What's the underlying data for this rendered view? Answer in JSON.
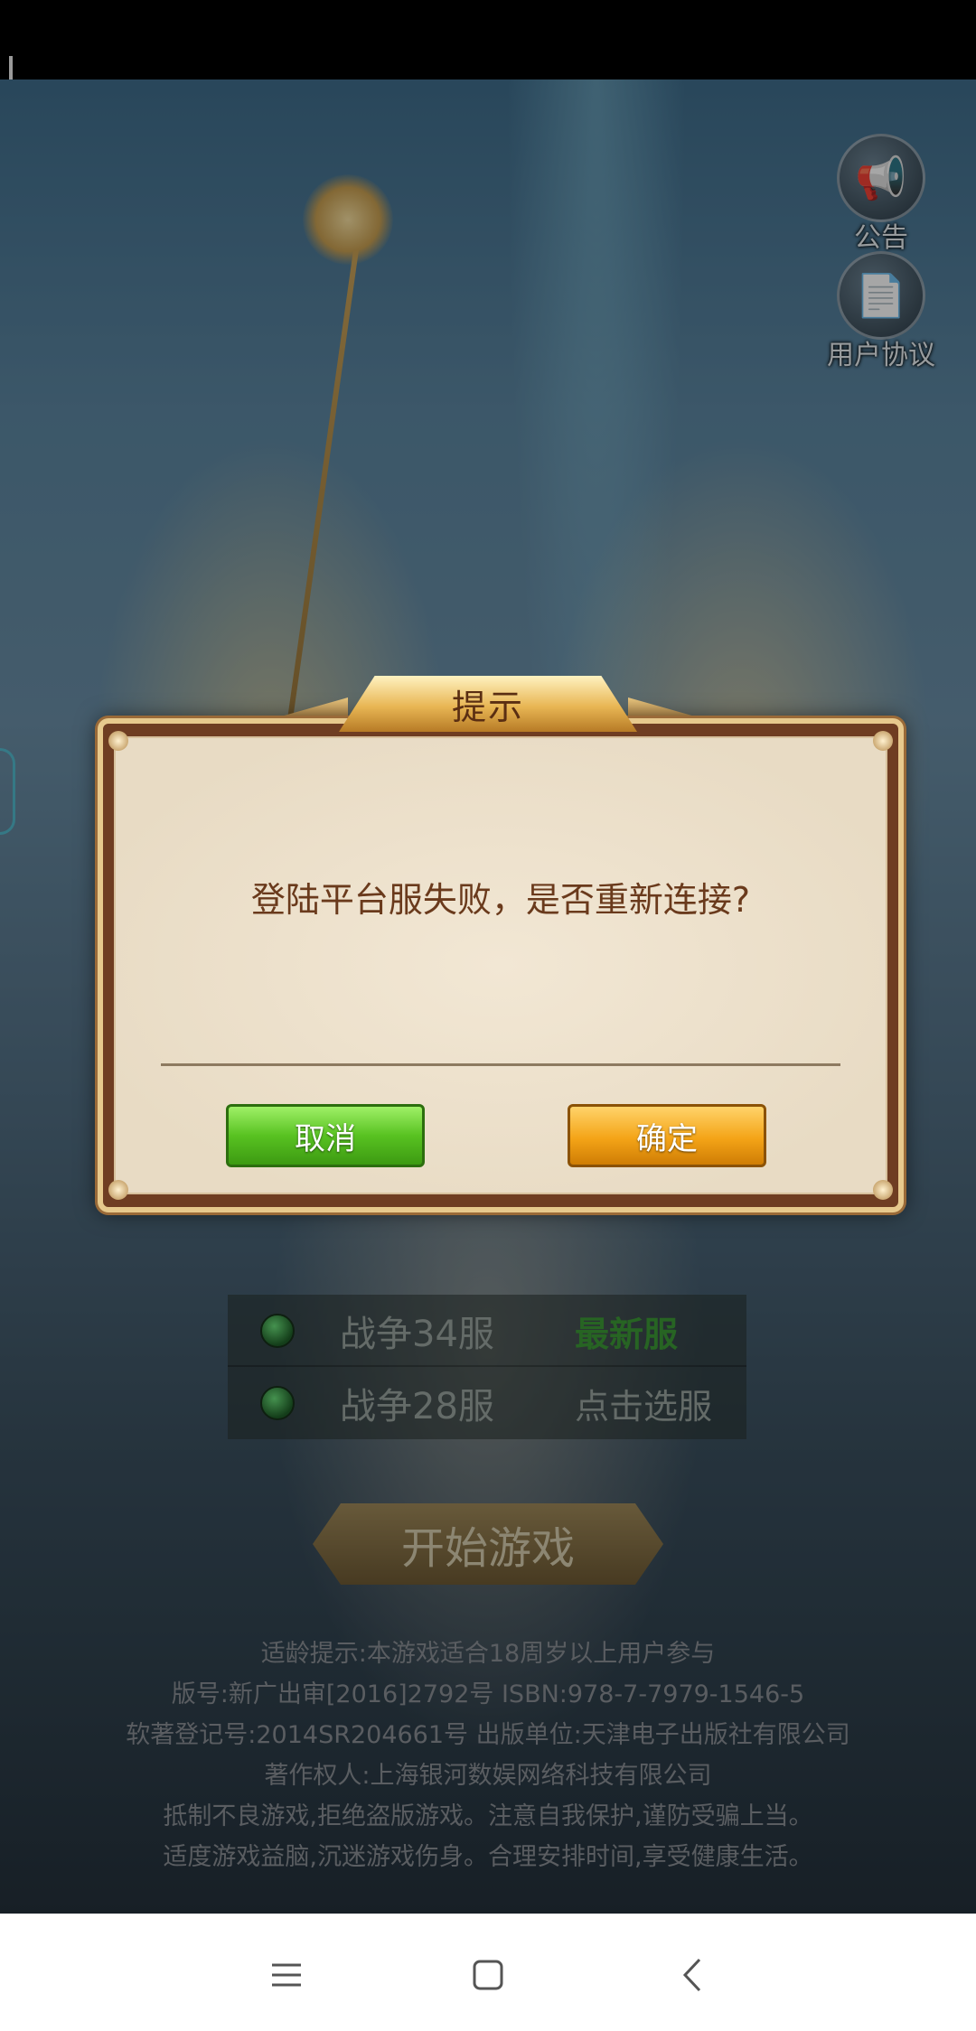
{
  "side_buttons": {
    "announcement": "公告",
    "user_agreement": "用户协议"
  },
  "servers": [
    {
      "name": "战争34服",
      "tag": "最新服"
    },
    {
      "name": "战争28服",
      "tag": "点击选服"
    }
  ],
  "start_button": "开始游戏",
  "legal_lines": [
    "适龄提示:本游戏适合18周岁以上用户参与",
    "版号:新广出审[2016]2792号    ISBN:978-7-7979-1546-5",
    "软著登记号:2014SR204661号 出版单位:天津电子出版社有限公司",
    "著作权人:上海银河数娱网络科技有限公司",
    "抵制不良游戏,拒绝盗版游戏。注意自我保护,谨防受骗上当。",
    "适度游戏益脑,沉迷游戏伤身。合理安排时间,享受健康生活。"
  ],
  "dialog": {
    "title": "提示",
    "message": "登陆平台服失败，是否重新连接?",
    "cancel_label": "取消",
    "confirm_label": "确定"
  },
  "icons": {
    "announcement": "megaphone-icon",
    "user_agreement": "document-icon",
    "nav_menu": "menu-icon",
    "nav_home": "home-square-icon",
    "nav_back": "back-chevron-icon"
  }
}
